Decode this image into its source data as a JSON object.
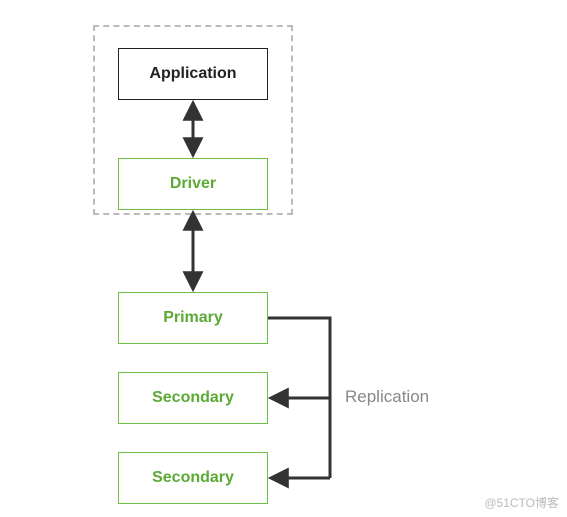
{
  "boxes": {
    "application": "Application",
    "driver": "Driver",
    "primary": "Primary",
    "secondary1": "Secondary",
    "secondary2": "Secondary"
  },
  "labels": {
    "replication": "Replication"
  },
  "watermark": "@51CTO博客",
  "colors": {
    "green": "#6fbf44",
    "greenText": "#5ca935",
    "dashed": "#bbb",
    "arrow": "#333",
    "label": "#888"
  }
}
